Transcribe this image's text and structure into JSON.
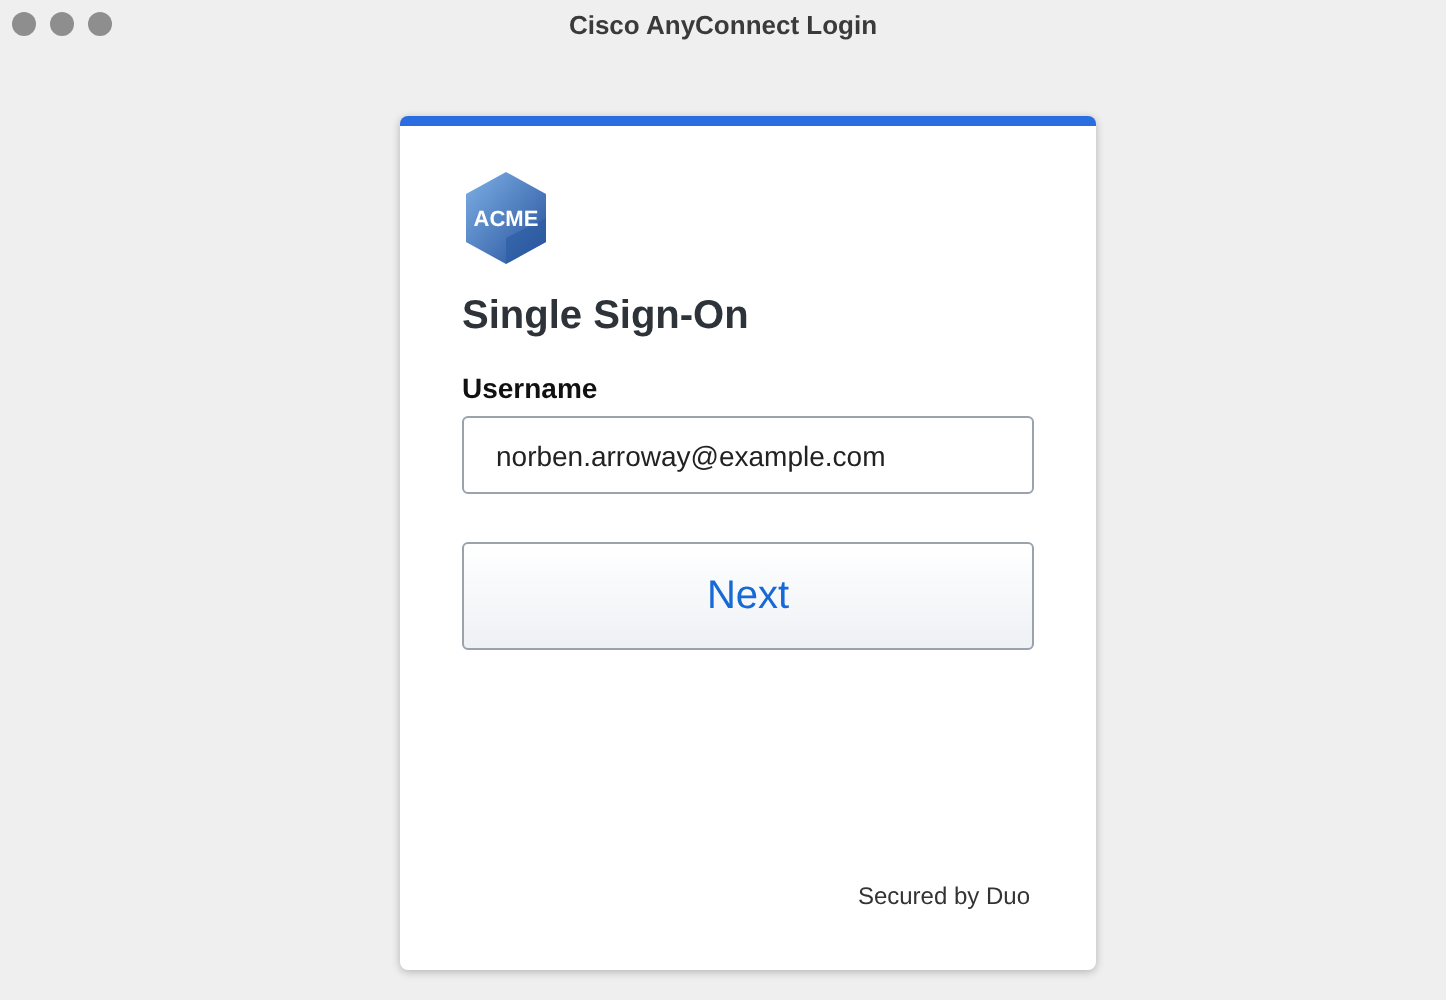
{
  "window": {
    "title": "Cisco AnyConnect Login"
  },
  "logo": {
    "text": "ACME"
  },
  "heading": "Single Sign-On",
  "username": {
    "label": "Username",
    "value": "norben.arroway@example.com"
  },
  "buttons": [
    "Next"
  ],
  "footer": "Secured by Duo"
}
